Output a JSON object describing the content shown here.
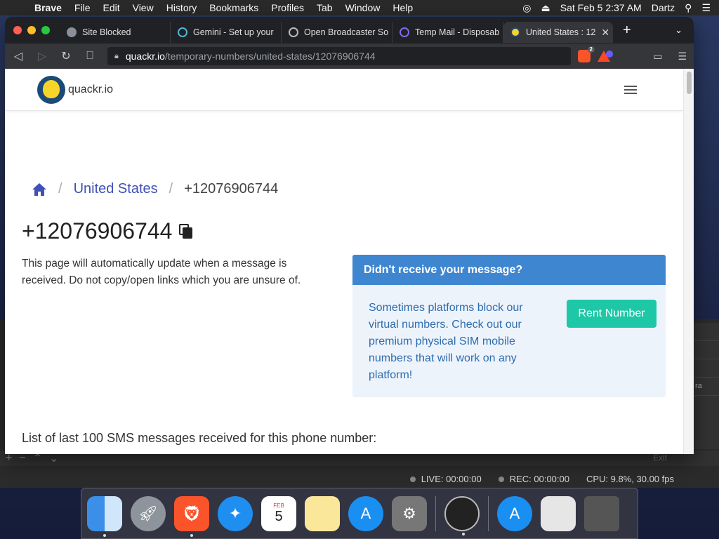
{
  "menubar": {
    "app_name": "Brave",
    "items": [
      "File",
      "Edit",
      "View",
      "History",
      "Bookmarks",
      "Profiles",
      "Tab",
      "Window",
      "Help"
    ],
    "datetime": "Sat Feb 5  2:37 AM",
    "user": "Dartz"
  },
  "browser": {
    "tabs": [
      {
        "label": "Site Blocked",
        "icon": "globe-icon"
      },
      {
        "label": "Gemini - Set up your",
        "icon": "gemini-icon"
      },
      {
        "label": "Open Broadcaster So",
        "icon": "obs-icon"
      },
      {
        "label": "Temp Mail - Disposab",
        "icon": "tempmail-icon"
      },
      {
        "label": "United States : 12",
        "icon": "quackr-icon"
      }
    ],
    "new_tab": "+",
    "url_host": "quackr.io",
    "url_path": "/temporary-numbers/united-states/12076906744",
    "shields_count": "2"
  },
  "site": {
    "logo_text": "quackr.io",
    "breadcrumb": {
      "separator": "/",
      "country": "United States",
      "number": "+12076906744"
    },
    "phone_number": "+12076906744",
    "description": "This page will automatically update when a message is received. Do not copy/open links which you are unsure of.",
    "card": {
      "title": "Didn't receive your message?",
      "body": "Sometimes platforms block our virtual numbers. Check out our premium physical SIM mobile numbers that will work on any platform!",
      "button": "Rent Number"
    },
    "list_title": "List of last 100 SMS messages received for this phone number:"
  },
  "obs": {
    "live": "LIVE: 00:00:00",
    "rec": "REC: 00:00:00",
    "cpu": "CPU: 9.8%, 30.00 fps",
    "exit": "Exit",
    "side_label": "ra"
  },
  "dock": {
    "calendar_month": "FEB",
    "calendar_day": "5"
  },
  "colors": {
    "accent_blue": "#3f51b5",
    "card_header": "#3f86d1",
    "rent_button": "#1ec7a6"
  }
}
